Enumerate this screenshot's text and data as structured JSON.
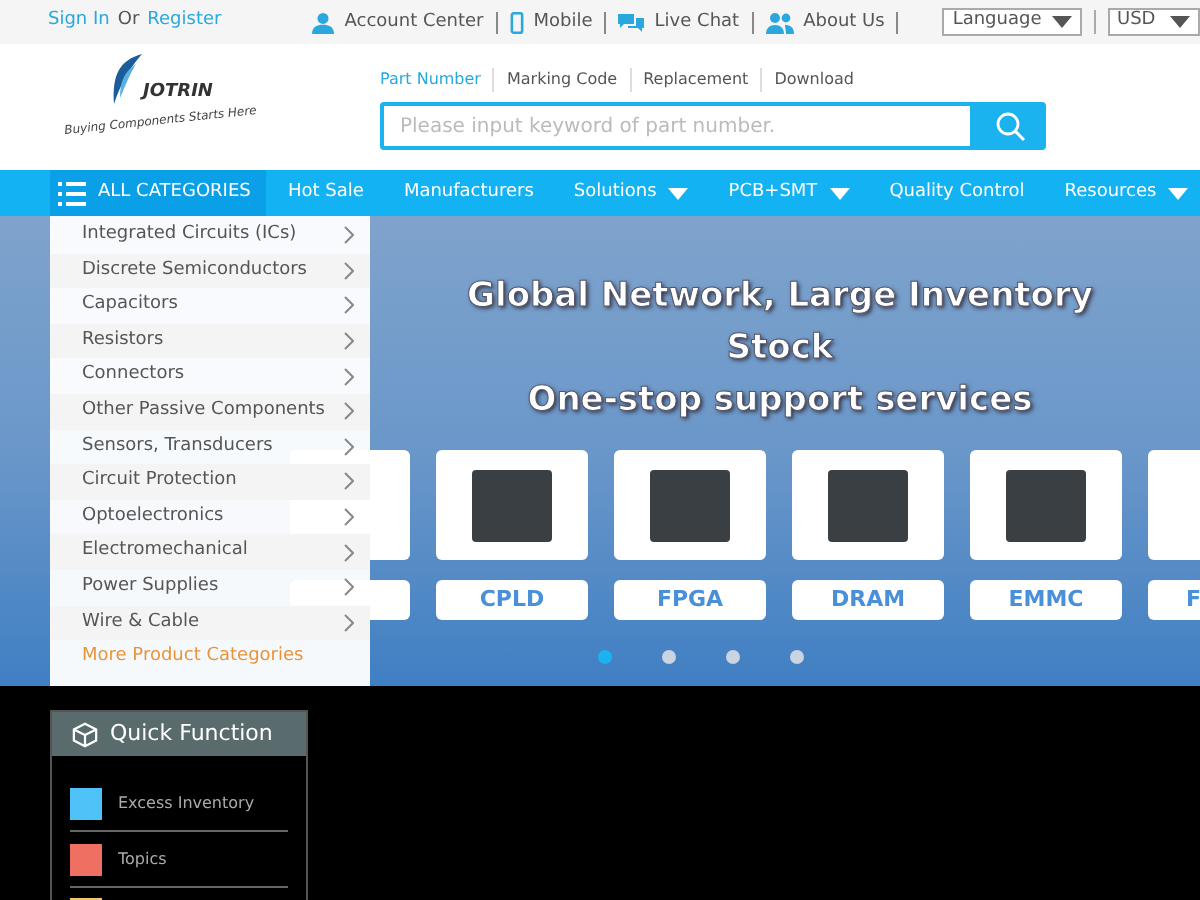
{
  "top_bar": {
    "sign_in": "Sign In",
    "or": "Or",
    "register": "Register",
    "links": [
      {
        "kind": "user",
        "label": "Account Center"
      },
      {
        "kind": "mobile",
        "label": "Mobile"
      },
      {
        "kind": "chat",
        "label": "Live Chat"
      },
      {
        "kind": "group",
        "label": "About Us"
      }
    ],
    "language": "Language",
    "currency": "USD"
  },
  "logo": {
    "name": "JOTRIN",
    "slogan": "Buying Components Starts Here"
  },
  "search": {
    "tabs": [
      {
        "label": "Part Number",
        "selected": true
      },
      {
        "label": "Marking Code",
        "selected": false
      },
      {
        "label": "Replacement",
        "selected": false
      },
      {
        "label": "Download",
        "selected": false
      }
    ],
    "placeholder": "Please input keyword of part number."
  },
  "nav": {
    "all_categories": "ALL CATEGORIES",
    "items": [
      {
        "label": "Hot Sale",
        "dropdown": false
      },
      {
        "label": "Manufacturers",
        "dropdown": false
      },
      {
        "label": "Solutions",
        "dropdown": true
      },
      {
        "label": "PCB+SMT",
        "dropdown": true
      },
      {
        "label": "Quality Control",
        "dropdown": false
      },
      {
        "label": "Resources",
        "dropdown": true
      }
    ]
  },
  "categories": {
    "items": [
      "Integrated Circuits (ICs)",
      "Discrete Semiconductors",
      "Capacitors",
      "Resistors",
      "Connectors",
      "Other Passive Components",
      "Sensors, Transducers",
      "Circuit Protection",
      "Optoelectronics",
      "Electromechanical",
      "Power Supplies",
      "Wire & Cable"
    ],
    "more": "More Product Categories"
  },
  "banner": {
    "headline": "Global Network, Large Inventory Stock",
    "subheadline": "One-stop support services",
    "products": [
      {
        "label": "CPLD"
      },
      {
        "label": "FPGA"
      },
      {
        "label": "DRAM"
      },
      {
        "label": "EMMC"
      }
    ],
    "cut_label": "F",
    "dots": [
      {
        "selected": true
      },
      {
        "selected": false
      },
      {
        "selected": false
      },
      {
        "selected": false
      }
    ]
  },
  "quick_function": {
    "title": "Quick Function",
    "items": [
      {
        "label": "Excess Inventory",
        "color": "#4fc3f7"
      },
      {
        "label": "Topics",
        "color": "#f06f63"
      }
    ]
  }
}
